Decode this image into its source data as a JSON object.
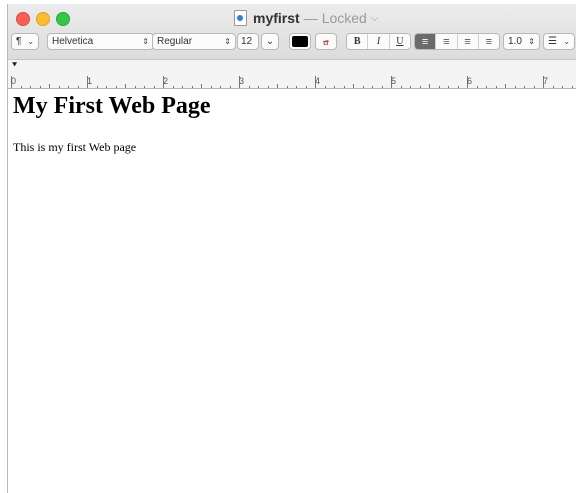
{
  "window": {
    "title": "myfirst",
    "dash": "—",
    "status": "Locked",
    "title_chevron": "⌵"
  },
  "toolbar": {
    "paragraph_styles": "¶",
    "paragraph_chevron": "⌄",
    "font_family": "Helvetica",
    "font_typeface": "Regular",
    "font_size": "12",
    "font_size_chevron": "⌄",
    "text_color": "#000000",
    "bg_color_icon": "a",
    "bold": "B",
    "italic": "I",
    "underline": "U",
    "alignment_options": [
      "left",
      "center",
      "right",
      "justify"
    ],
    "active_alignment": "left",
    "line_spacing": "1.0",
    "list_icon": "☰",
    "list_chevron": "⌄"
  },
  "ruler": {
    "numbers": [
      "0",
      "1",
      "2",
      "3",
      "4",
      "5",
      "6",
      "7"
    ]
  },
  "document": {
    "heading": "My First Web Page",
    "paragraph": "This is my first Web page"
  },
  "colors": {
    "close": "#fc5f57",
    "minimize": "#fdbc2e",
    "zoom": "#33c748",
    "active_align": "#6b6b6b"
  }
}
